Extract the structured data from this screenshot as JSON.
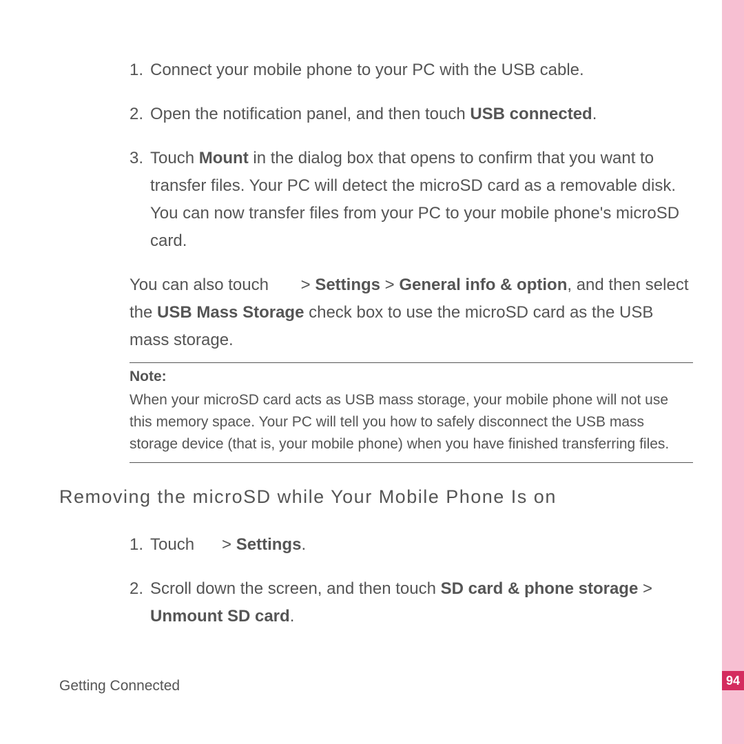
{
  "listA": {
    "i1": {
      "n": "1.",
      "t": "Connect your mobile phone to your PC with the USB cable."
    },
    "i2": {
      "n": "2.",
      "pre": "Open the notification panel, and then touch ",
      "b1": "USB connected",
      "post": "."
    },
    "i3": {
      "n": "3.",
      "pre": "Touch ",
      "b1": "Mount",
      "post": " in the dialog box that opens to confirm that you want to transfer files. Your PC will detect the microSD card as a removable disk. You can now transfer files from your PC to your mobile phone's microSD card."
    }
  },
  "sub": {
    "p1": "You can also touch ",
    "gap": "      > ",
    "b1": "Settings",
    "sep1": " > ",
    "b2": "General info & option",
    "mid": ", and then select the ",
    "b3": "USB Mass Storage",
    "post": " check box to use the microSD card as the USB mass storage."
  },
  "note": {
    "label": "Note:",
    "body": "When your microSD card acts as USB mass storage, your mobile phone will not use this memory space. Your PC will tell you how to safely disconnect the USB mass storage device (that is, your mobile phone) when you have finished transferring files."
  },
  "heading": "Removing the microSD while Your Mobile Phone Is on",
  "listB": {
    "i1": {
      "n": "1.",
      "pre": "Touch ",
      "gap": "     > ",
      "b1": "Settings",
      "post": "."
    },
    "i2": {
      "n": "2.",
      "pre": "Scroll down the screen, and then touch ",
      "b1": "SD card & phone storage",
      "sep": " > ",
      "b2": "Unmount SD card",
      "post": "."
    }
  },
  "footer": "Getting Connected",
  "pageNum": "94"
}
